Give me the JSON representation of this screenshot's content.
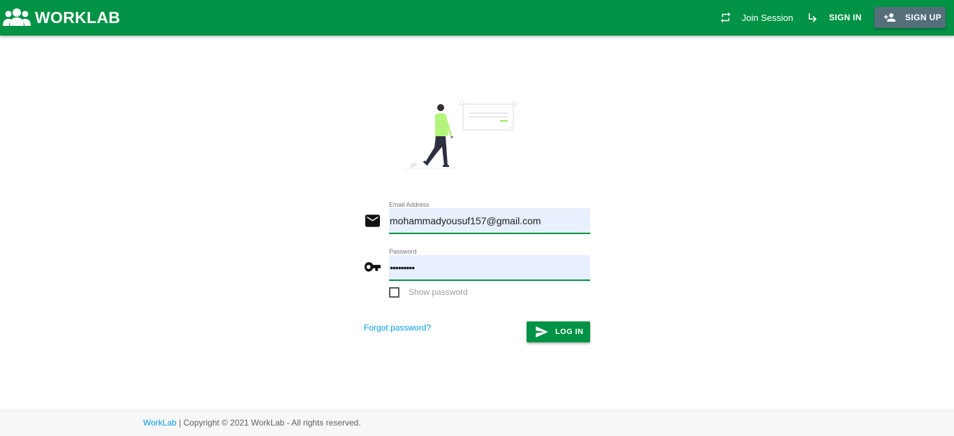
{
  "header": {
    "brand_name": "WORKLAB",
    "nav": {
      "join_session": "Join Session",
      "sign_in": "SIGN IN",
      "sign_up": "SIGN UP"
    },
    "colors": {
      "bar": "#009245",
      "signup_button": "#546e7a"
    }
  },
  "login_form": {
    "email": {
      "label": "Email Address",
      "value": "mohammadyousuf157@gmail.com",
      "icon": "mail-icon"
    },
    "password": {
      "label": "Password",
      "value": "•••••••••",
      "icon": "key-icon"
    },
    "show_password_label": "Show password",
    "show_password_checked": false,
    "forgot_password": "Forgot password?",
    "login_button": "LOG IN"
  },
  "footer": {
    "brand": "WorkLab",
    "text": " | Copyright © 2021 WorkLab - All rights reserved."
  }
}
